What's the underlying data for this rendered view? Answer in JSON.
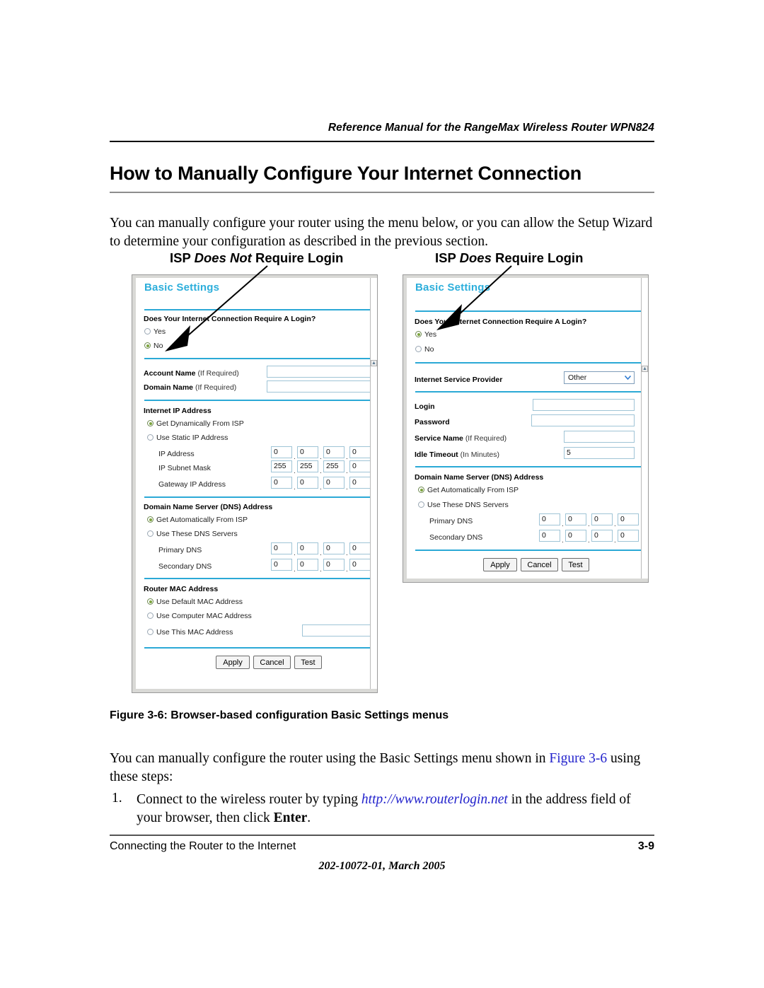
{
  "document": {
    "running_head": "Reference Manual for the RangeMax Wireless Router WPN824",
    "heading": "How to Manually Configure Your Internet Connection",
    "intro_paragraph": "You can manually configure your router using the menu below, or you can allow the Setup Wizard to determine your configuration as described in the previous section.",
    "figure_caption": "Figure 3-6:  Browser-based configuration Basic Settings menus",
    "after_figure_paragraph_1": "You can manually configure the router using the Basic Settings menu shown in ",
    "after_figure_link": "Figure 3-6",
    "after_figure_paragraph_2": " using these steps:",
    "step_number": "1.",
    "step_text_1": "Connect to the wireless router by typing ",
    "step_url": "http://www.routerlogin.net",
    "step_text_2": " in the address field of your browser, then click ",
    "step_bold": "Enter",
    "step_text_3": ".",
    "footer_left": "Connecting the Router to the Internet",
    "footer_page": "3-9",
    "footer_center": "202-10072-01, March 2005"
  },
  "colors": {
    "panel_title": "#2CAEDB",
    "divider_blue": "#2BA9D6",
    "radio_selected": "#7ba33c",
    "link_blue": "#2222cc"
  },
  "figure": {
    "left_caption_prefix": "ISP ",
    "left_caption_italic": "Does Not",
    "left_caption_suffix": " Require Login",
    "right_caption_prefix": "ISP ",
    "right_caption_italic": "Does",
    "right_caption_suffix": " Require Login"
  },
  "panel_left": {
    "title": "Basic Settings",
    "login_question": "Does Your Internet Connection Require A Login?",
    "login_options": [
      {
        "label": "Yes",
        "selected": false
      },
      {
        "label": "No",
        "selected": true
      }
    ],
    "account_name_label": "Account Name",
    "account_name_hint": "(If Required)",
    "account_name_value": "",
    "domain_name_label": "Domain Name",
    "domain_name_hint": "(If Required)",
    "domain_name_value": "",
    "ip_section": "Internet IP Address",
    "ip_options": [
      {
        "label": "Get Dynamically From ISP",
        "selected": true
      },
      {
        "label": "Use Static IP Address",
        "selected": false
      }
    ],
    "ip_rows": [
      {
        "label": "IP Address",
        "octets": [
          "0",
          "0",
          "0",
          "0"
        ]
      },
      {
        "label": "IP Subnet Mask",
        "octets": [
          "255",
          "255",
          "255",
          "0"
        ]
      },
      {
        "label": "Gateway IP Address",
        "octets": [
          "0",
          "0",
          "0",
          "0"
        ]
      }
    ],
    "dns_section": "Domain Name Server (DNS) Address",
    "dns_options": [
      {
        "label": "Get Automatically From ISP",
        "selected": true
      },
      {
        "label": "Use These DNS Servers",
        "selected": false
      }
    ],
    "dns_rows": [
      {
        "label": "Primary DNS",
        "octets": [
          "0",
          "0",
          "0",
          "0"
        ]
      },
      {
        "label": "Secondary DNS",
        "octets": [
          "0",
          "0",
          "0",
          "0"
        ]
      }
    ],
    "mac_section": "Router MAC Address",
    "mac_options": [
      {
        "label": "Use Default MAC Address",
        "selected": true
      },
      {
        "label": "Use Computer MAC Address",
        "selected": false
      },
      {
        "label": "Use This MAC Address",
        "selected": false
      }
    ],
    "mac_value": "",
    "buttons": [
      "Apply",
      "Cancel",
      "Test"
    ]
  },
  "panel_right": {
    "title": "Basic Settings",
    "login_question": "Does Your Internet Connection Require A Login?",
    "login_options": [
      {
        "label": "Yes",
        "selected": true
      },
      {
        "label": "No",
        "selected": false
      }
    ],
    "isp_label": "Internet Service Provider",
    "isp_value": "Other",
    "login_label": "Login",
    "login_value": "",
    "password_label": "Password",
    "password_value": "",
    "service_name_label": "Service Name",
    "service_name_hint": "(If Required)",
    "service_name_value": "",
    "idle_timeout_label": "Idle Timeout",
    "idle_timeout_hint": "(In Minutes)",
    "idle_timeout_value": "5",
    "dns_section": "Domain Name Server (DNS) Address",
    "dns_options": [
      {
        "label": "Get Automatically From ISP",
        "selected": true
      },
      {
        "label": "Use These DNS Servers",
        "selected": false
      }
    ],
    "dns_rows": [
      {
        "label": "Primary DNS",
        "octets": [
          "0",
          "0",
          "0",
          "0"
        ]
      },
      {
        "label": "Secondary DNS",
        "octets": [
          "0",
          "0",
          "0",
          "0"
        ]
      }
    ],
    "buttons": [
      "Apply",
      "Cancel",
      "Test"
    ]
  }
}
